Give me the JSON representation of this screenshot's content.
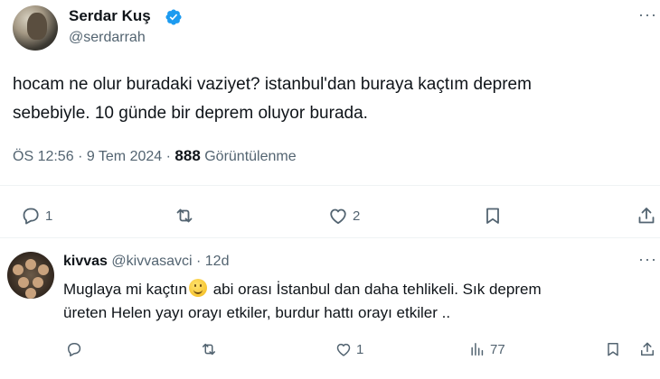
{
  "tweet": {
    "display_name": "Serdar Kuş",
    "handle": "@serdarrah",
    "more": "···",
    "text_line1": "hocam ne olur buradaki vaziyet? istanbul'dan buraya kaçtım deprem",
    "text_line2": "sebebiyle. 10 günde bir deprem oluyor burada.",
    "time": "ÖS 12:56",
    "date": "9 Tem 2024",
    "views_count": "888",
    "views_label": "Görüntülenme",
    "reply_count": "1",
    "retweet_count": "",
    "like_count": "2"
  },
  "reply": {
    "display_name": "kivvas",
    "handle": "@kivvasavci",
    "age": "12d",
    "more": "···",
    "text_part1": "Muglaya mi kaçtın",
    "text_part2": " abi orası İstanbul dan daha tehlikeli. Sık deprem",
    "text_line2": "üreten Helen yayı orayı etkiler, burdur hattı orayı etkiler ..",
    "reply_count": "",
    "retweet_count": "",
    "like_count": "1",
    "views_count": "77"
  },
  "colors": {
    "text": "#0f1419",
    "muted": "#536471",
    "verified": "#1d9bf0",
    "divider": "#eff3f4"
  }
}
